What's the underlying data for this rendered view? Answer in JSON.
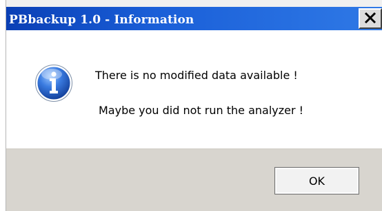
{
  "dialog": {
    "title": "PBbackup 1.0 - Information",
    "close_glyph": "✕",
    "icon": "information-icon",
    "messages": [
      "There is no modified data available !",
      "Maybe you did not run the analyzer !"
    ],
    "ok_label": "OK"
  },
  "colors": {
    "titlebar": "#1a5fd8",
    "content_bg": "#ffffff",
    "footer_bg": "#d8d5cf",
    "icon_blue": "#1f5fc8"
  }
}
